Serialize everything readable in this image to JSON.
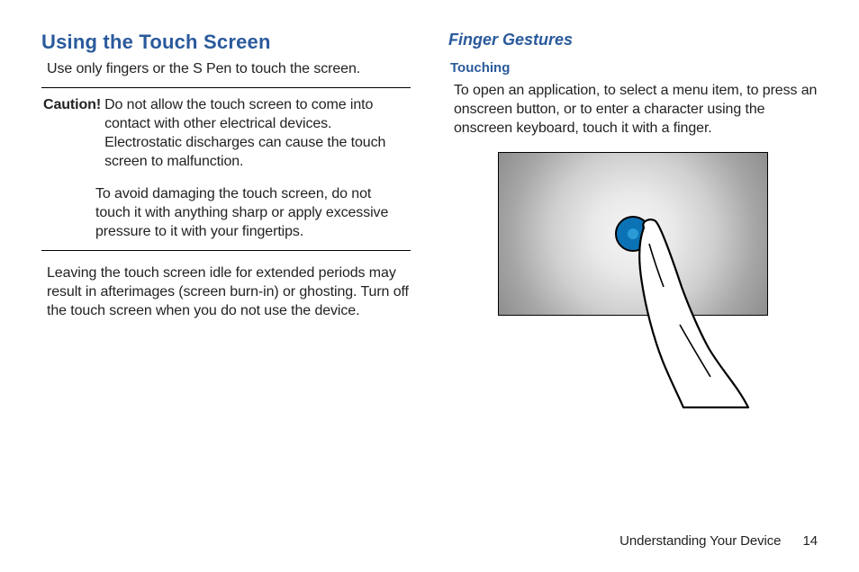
{
  "left": {
    "heading": "Using the Touch Screen",
    "intro": "Use only fingers or the S Pen to touch the screen.",
    "caution_label": "Caution!",
    "caution_p1": "Do not allow the touch screen to come into contact with other electrical devices. Electrostatic discharges can cause the touch screen to malfunction.",
    "caution_p2": "To avoid damaging the touch screen, do not touch it with anything sharp or apply excessive pressure to it with your fingertips.",
    "idle": "Leaving the touch screen idle for extended periods may result in afterimages (screen burn-in) or ghosting. Turn off the touch screen when you do not use the device."
  },
  "right": {
    "section": "Finger Gestures",
    "sub": "Touching",
    "touching_text": "To open an application, to select a menu item, to press an onscreen button, or to enter a character using the onscreen keyboard, touch it with a finger."
  },
  "footer": {
    "chapter": "Understanding Your Device",
    "page": "14"
  }
}
